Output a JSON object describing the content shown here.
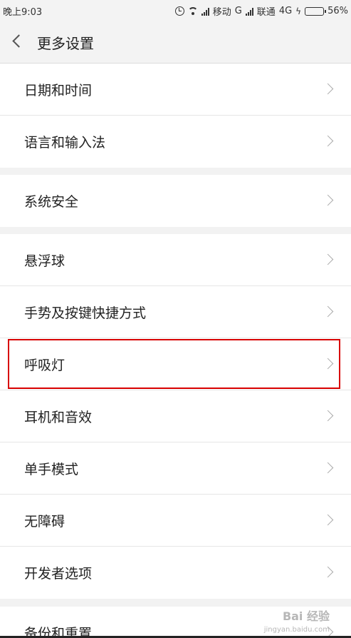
{
  "status_bar": {
    "time": "晚上9:03",
    "carrier1": "移动",
    "network1": "G",
    "carrier2": "联通",
    "network2": "4G",
    "battery": "56%",
    "battery_level": 0.56,
    "battery_color": "#2ab42a"
  },
  "header": {
    "title": "更多设置"
  },
  "groups": [
    {
      "items": [
        "日期和时间",
        "语言和输入法"
      ]
    },
    {
      "items": [
        "系统安全"
      ]
    },
    {
      "items": [
        "悬浮球",
        "手势及按键快捷方式",
        "呼吸灯",
        "耳机和音效",
        "单手模式",
        "无障碍",
        "开发者选项"
      ]
    },
    {
      "items": [
        "备份和重置"
      ]
    }
  ],
  "highlight": {
    "item": "呼吸灯",
    "color": "#d80000"
  },
  "watermark": {
    "text": "Bai 经验",
    "sub": "jingyan.baidu.com"
  }
}
